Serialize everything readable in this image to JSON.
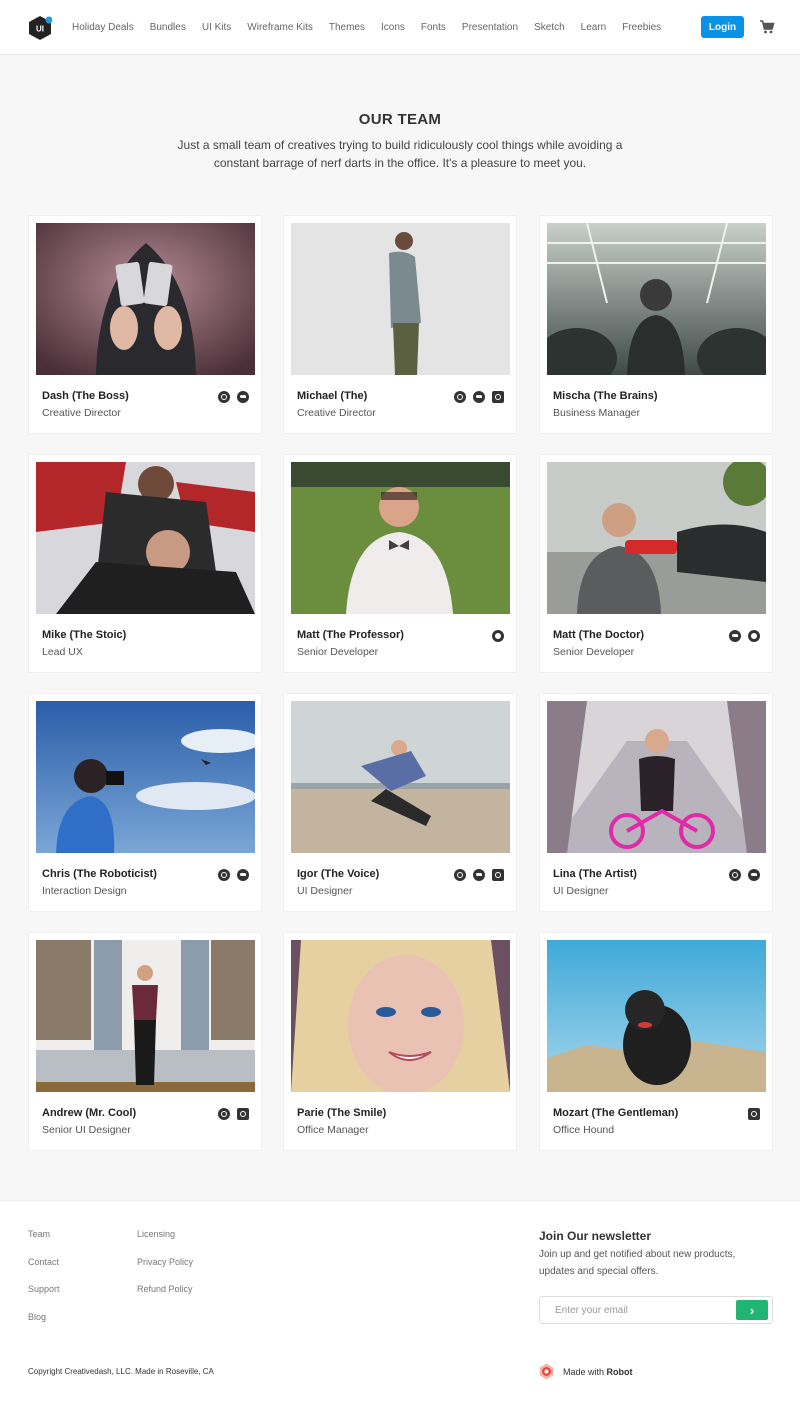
{
  "header": {
    "logo_text": "UI",
    "nav": [
      "Holiday Deals",
      "Bundles",
      "UI Kits",
      "Wireframe Kits",
      "Themes",
      "Icons",
      "Fonts",
      "Presentation",
      "Sketch",
      "Learn",
      "Freebies"
    ],
    "login_label": "Login"
  },
  "intro": {
    "title": "OUR TEAM",
    "subtitle": "Just a small team of creatives trying to build ridiculously cool things while avoiding a constant barrage of nerf darts in the office. It's a pleasure to meet you."
  },
  "team": [
    {
      "name": "Dash (The Boss)",
      "role": "Creative Director",
      "socials": [
        "dribbble",
        "twitter"
      ]
    },
    {
      "name": "Michael (The)",
      "role": "Creative Director",
      "socials": [
        "dribbble",
        "twitter",
        "instagram"
      ]
    },
    {
      "name": "Mischa (The Brains)",
      "role": "Business Manager",
      "socials": []
    },
    {
      "name": "Mike (The Stoic)",
      "role": "Lead UX",
      "socials": []
    },
    {
      "name": "Matt (The Professor)",
      "role": "Senior Developer",
      "socials": [
        "github"
      ]
    },
    {
      "name": "Matt (The Doctor)",
      "role": "Senior Developer",
      "socials": [
        "twitter",
        "github"
      ]
    },
    {
      "name": "Chris (The Roboticist)",
      "role": "Interaction Design",
      "socials": [
        "dribbble",
        "twitter"
      ]
    },
    {
      "name": "Igor (The Voice)",
      "role": "UI Designer",
      "socials": [
        "dribbble",
        "twitter",
        "instagram"
      ]
    },
    {
      "name": "Lina (The Artist)",
      "role": "UI Designer",
      "socials": [
        "dribbble",
        "twitter"
      ]
    },
    {
      "name": "Andrew (Mr. Cool)",
      "role": "Senior UI Designer",
      "socials": [
        "dribbble",
        "instagram"
      ]
    },
    {
      "name": "Parie (The Smile)",
      "role": "Office Manager",
      "socials": []
    },
    {
      "name": "Mozart (The Gentleman)",
      "role": "Office Hound",
      "socials": [
        "instagram"
      ]
    }
  ],
  "footer": {
    "col1": [
      "Team",
      "Contact",
      "Support",
      "Blog"
    ],
    "col2": [
      "Licensing",
      "Privacy Policy",
      "Refund Policy"
    ],
    "newsletter_title": "Join Our newsletter",
    "newsletter_text": "Join up and get notified about new products, updates and special offers.",
    "email_placeholder": "Enter your email",
    "copyright": "Copyright Creativedash, LLC. Made in Roseville, CA",
    "made_with_prefix": "Made with",
    "made_with_brand": "Robot"
  }
}
